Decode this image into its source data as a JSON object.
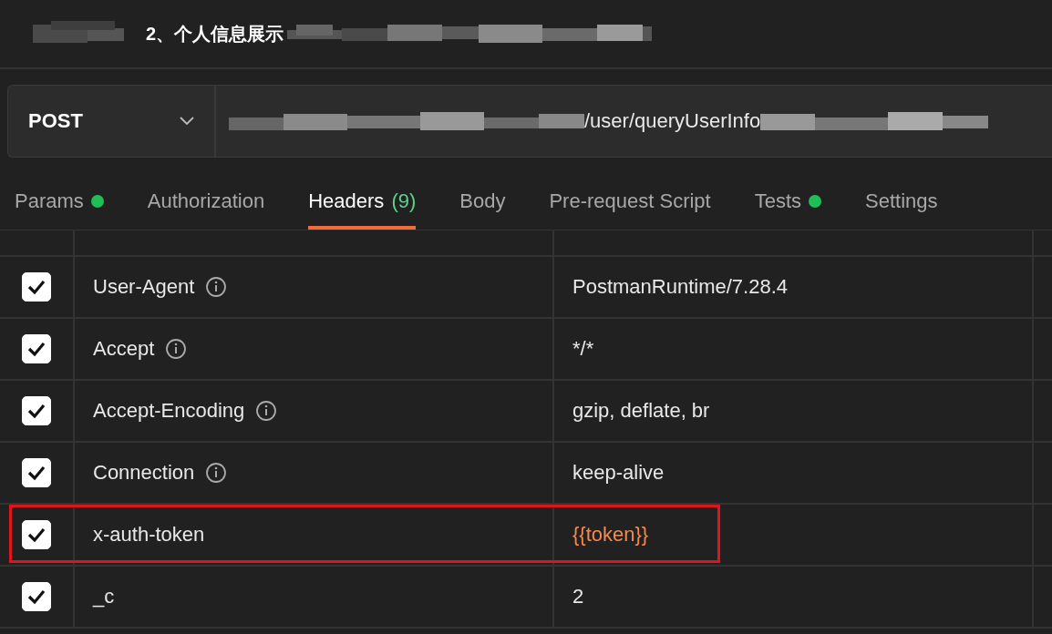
{
  "header": {
    "title": "2、个人信息展示"
  },
  "request": {
    "method": "POST",
    "url": "/user/queryUserInfo"
  },
  "tabs": [
    {
      "label": "Params",
      "dot": true,
      "selected": false
    },
    {
      "label": "Authorization",
      "dot": false,
      "selected": false
    },
    {
      "label": "Headers",
      "count": "(9)",
      "dot": false,
      "selected": true
    },
    {
      "label": "Body",
      "dot": false,
      "selected": false
    },
    {
      "label": "Pre-request Script",
      "dot": false,
      "selected": false
    },
    {
      "label": "Tests",
      "dot": true,
      "selected": false
    },
    {
      "label": "Settings",
      "dot": false,
      "selected": false
    }
  ],
  "headers": [
    {
      "key": "User-Agent",
      "info": true,
      "value": "PostmanRuntime/7.28.4",
      "kind": "text",
      "checked": true,
      "highlighted": false
    },
    {
      "key": "Accept",
      "info": true,
      "value": "*/*",
      "kind": "text",
      "checked": true,
      "highlighted": false
    },
    {
      "key": "Accept-Encoding",
      "info": true,
      "value": "gzip, deflate, br",
      "kind": "text",
      "checked": true,
      "highlighted": false
    },
    {
      "key": "Connection",
      "info": true,
      "value": "keep-alive",
      "kind": "text",
      "checked": true,
      "highlighted": false
    },
    {
      "key": "x-auth-token",
      "info": false,
      "value": "{{token}}",
      "kind": "variable",
      "checked": true,
      "highlighted": true
    },
    {
      "key": "_c",
      "info": false,
      "value": "2",
      "kind": "text",
      "checked": true,
      "highlighted": false
    }
  ]
}
